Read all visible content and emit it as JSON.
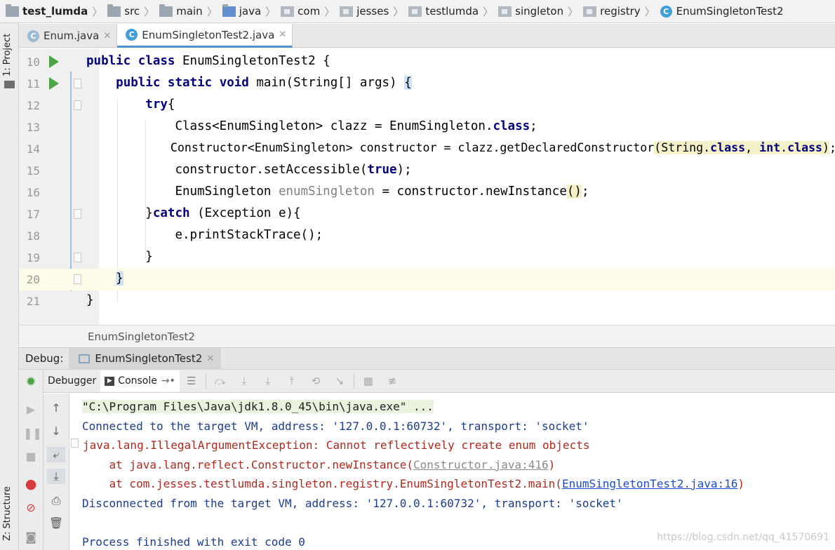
{
  "breadcrumb": [
    "test_lumda",
    "src",
    "main",
    "java",
    "com",
    "jesses",
    "testlumda",
    "singleton",
    "registry",
    "EnumSingletonTest2"
  ],
  "side_tabs": {
    "project": "1: Project",
    "structure": "Z: Structure"
  },
  "editor_tabs": [
    {
      "label": "Enum.java",
      "active": false
    },
    {
      "label": "EnumSingletonTest2.java",
      "active": true
    }
  ],
  "code": {
    "l10": {
      "num": "10",
      "kw1": "public",
      "kw2": "class",
      "rest": "EnumSingletonTest2 {"
    },
    "l11": {
      "num": "11",
      "kw1": "public",
      "kw2": "static",
      "kw3": "void",
      "rest": "main(String[] args)",
      "brace": "{"
    },
    "l12": {
      "num": "12",
      "kw": "try",
      "rest": "{"
    },
    "l13": {
      "num": "13",
      "a": "Class<EnumSingleton> clazz = EnumSingleton.",
      "kw": "class",
      "b": ";"
    },
    "l14": {
      "num": "14",
      "a": "Constructor<EnumSingleton> constructor = clazz.getDeclaredConstructor",
      "p1": "(String.",
      "kw1": "class",
      "c": ", ",
      "kw2": "int",
      "d": ".",
      "kw3": "class",
      "p2": ")",
      "e": ";"
    },
    "l15": {
      "num": "15",
      "a": "constructor.setAccessible(",
      "kw": "true",
      "b": ");"
    },
    "l16": {
      "num": "16",
      "a": "EnumSingleton ",
      "g": "enumSingleton",
      "b": " = constructor.newInstance",
      "p": "()",
      "c": ";"
    },
    "l17": {
      "num": "17",
      "a": "}",
      "kw": "catch",
      "b": " (Exception e){"
    },
    "l18": {
      "num": "18",
      "a": "e.printStackTrace();"
    },
    "l19": {
      "num": "19",
      "a": "}"
    },
    "l20": {
      "num": "20",
      "a": "}"
    },
    "l21": {
      "num": "21",
      "a": "}"
    }
  },
  "method_crumb": "EnumSingletonTest2",
  "debug": {
    "label": "Debug:",
    "tab": "EnumSingletonTest2"
  },
  "toolbar": {
    "debugger": "Debugger",
    "console": "Console"
  },
  "console": {
    "cmd": "\"C:\\Program Files\\Java\\jdk1.8.0_45\\bin\\java.exe\" ...",
    "connected": "Connected to the target VM, address: '127.0.0.1:60732', transport: 'socket'",
    "exception": "java.lang.IllegalArgumentException: Cannot reflectively create enum objects",
    "at1_prefix": "    at java.lang.reflect.Constructor.newInstance(",
    "at1_link": "Constructor.java:416",
    "at1_suffix": ")",
    "at2_prefix": "    at com.jesses.testlumda.singleton.registry.EnumSingletonTest2.main(",
    "at2_link": "EnumSingletonTest2.java:16",
    "at2_suffix": ")",
    "disconnected": "Disconnected from the target VM, address: '127.0.0.1:60732', transport: 'socket'",
    "finished": "Process finished with exit code 0"
  },
  "watermark": "https://blog.csdn.net/qq_41570691",
  "colors": {
    "keyword": "#000080",
    "run": "#4aa544",
    "error": "#b0281e",
    "info": "#1c3c94",
    "current_line": "#fcfce8"
  }
}
